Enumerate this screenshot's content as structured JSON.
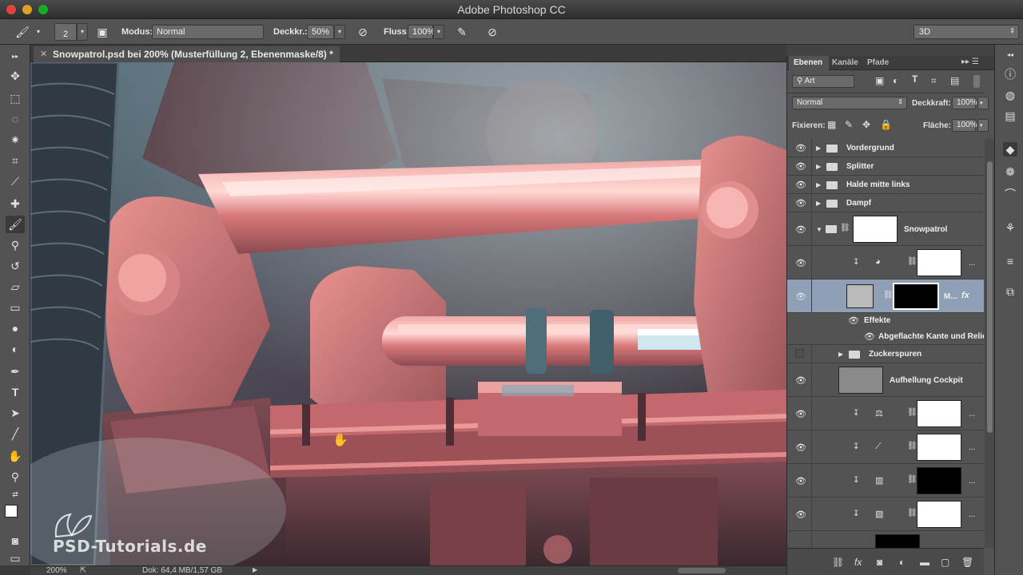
{
  "window": {
    "title": "Adobe Photoshop CC"
  },
  "options": {
    "brush_size": "2",
    "mode_label": "Modus:",
    "mode_value": "Normal",
    "opacity_label": "Deckkr.:",
    "opacity_value": "50%",
    "flow_label": "Fluss:",
    "flow_value": "100%",
    "workspace": "3D"
  },
  "document": {
    "tab_title": "Snowpatrol.psd bei 200% (Musterfüllung 2, Ebenenmaske/8) *",
    "zoom": "200%",
    "doc_info": "Dok: 64,4 MB/1,57 GB"
  },
  "watermark": "PSD-Tutorials.de",
  "layers_panel": {
    "tabs": [
      "Ebenen",
      "Kanäle",
      "Pfade"
    ],
    "filter_kind": "Art",
    "blend_mode": "Normal",
    "opacity_label": "Deckkraft:",
    "opacity_value": "100%",
    "lock_label": "Fixieren:",
    "fill_label": "Fläche:",
    "fill_value": "100%",
    "layers": [
      {
        "name": "Vordergrund",
        "type": "group",
        "visible": true
      },
      {
        "name": "Splitter",
        "type": "group",
        "visible": true
      },
      {
        "name": "Halde mitte links",
        "type": "group",
        "visible": true
      },
      {
        "name": "Dampf",
        "type": "group",
        "visible": true
      },
      {
        "name": "Snowpatrol",
        "type": "group-open",
        "visible": true
      },
      {
        "name": "...",
        "type": "adjustment",
        "visible": true
      },
      {
        "name": "M...",
        "type": "pattern-fill",
        "visible": true,
        "selected": true,
        "fx": "fx"
      },
      {
        "name": "Effekte",
        "type": "effects-header"
      },
      {
        "name": "Abgeflachte Kante und Relief",
        "type": "effect"
      },
      {
        "name": "Zuckerspuren",
        "type": "group",
        "visible": false
      },
      {
        "name": "Aufhellung Cockpit",
        "type": "layer",
        "visible": true
      },
      {
        "name": "...",
        "type": "adjustment",
        "visible": true
      },
      {
        "name": "...",
        "type": "adjustment",
        "visible": true
      },
      {
        "name": "...",
        "type": "adjustment",
        "visible": true
      },
      {
        "name": "...",
        "type": "adjustment",
        "visible": true
      }
    ]
  },
  "icons": {
    "eye": "eye-icon",
    "folder": "folder-icon",
    "chain": "link-icon"
  },
  "colors": {
    "selection": "#8e9fb6",
    "panel": "#535353",
    "accent_pink": "#d8787a"
  }
}
